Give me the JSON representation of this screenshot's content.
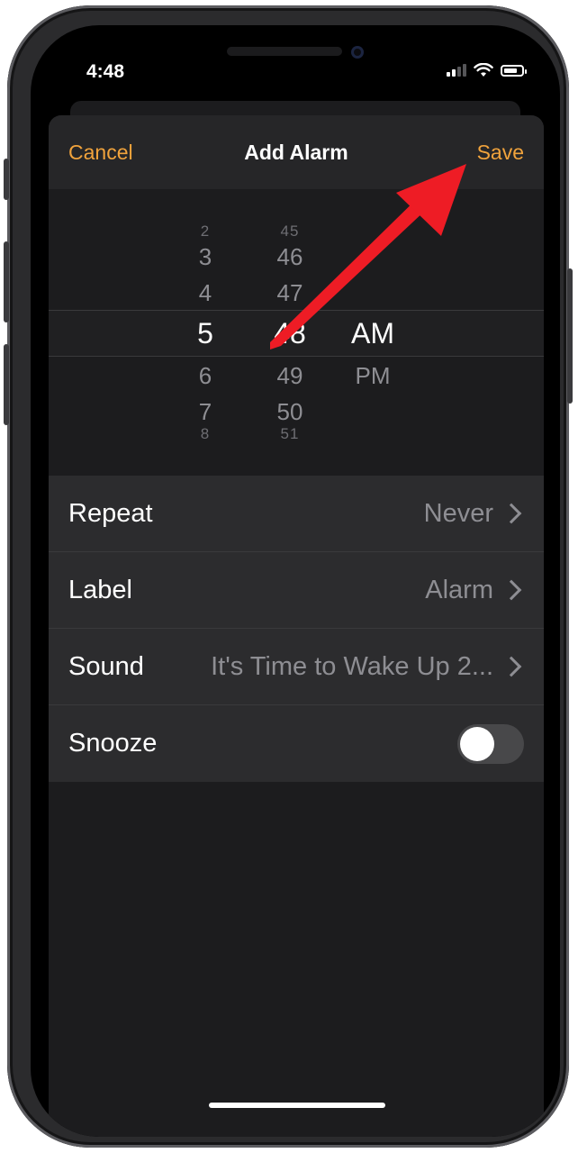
{
  "status_bar": {
    "time": "4:48",
    "icons": [
      "signal-icon",
      "wifi-icon",
      "battery-icon"
    ]
  },
  "nav": {
    "cancel_label": "Cancel",
    "title": "Add Alarm",
    "save_label": "Save"
  },
  "picker": {
    "hours": [
      "2",
      "3",
      "4",
      "5",
      "6",
      "7",
      "8"
    ],
    "minutes": [
      "45",
      "46",
      "47",
      "48",
      "49",
      "50",
      "51"
    ],
    "periods": [
      "AM",
      "PM"
    ],
    "selected": {
      "hour": "5",
      "minute": "48",
      "period": "AM"
    }
  },
  "settings": {
    "repeat": {
      "label": "Repeat",
      "value": "Never"
    },
    "label": {
      "label": "Label",
      "value": "Alarm"
    },
    "sound": {
      "label": "Sound",
      "value": "It's Time to Wake Up 2..."
    },
    "snooze": {
      "label": "Snooze",
      "enabled": false
    }
  },
  "colors": {
    "accent": "#f1a33c",
    "background": "#1c1c1e",
    "row_background": "#2c2c2e",
    "annotation_arrow": "#ee1c25"
  }
}
